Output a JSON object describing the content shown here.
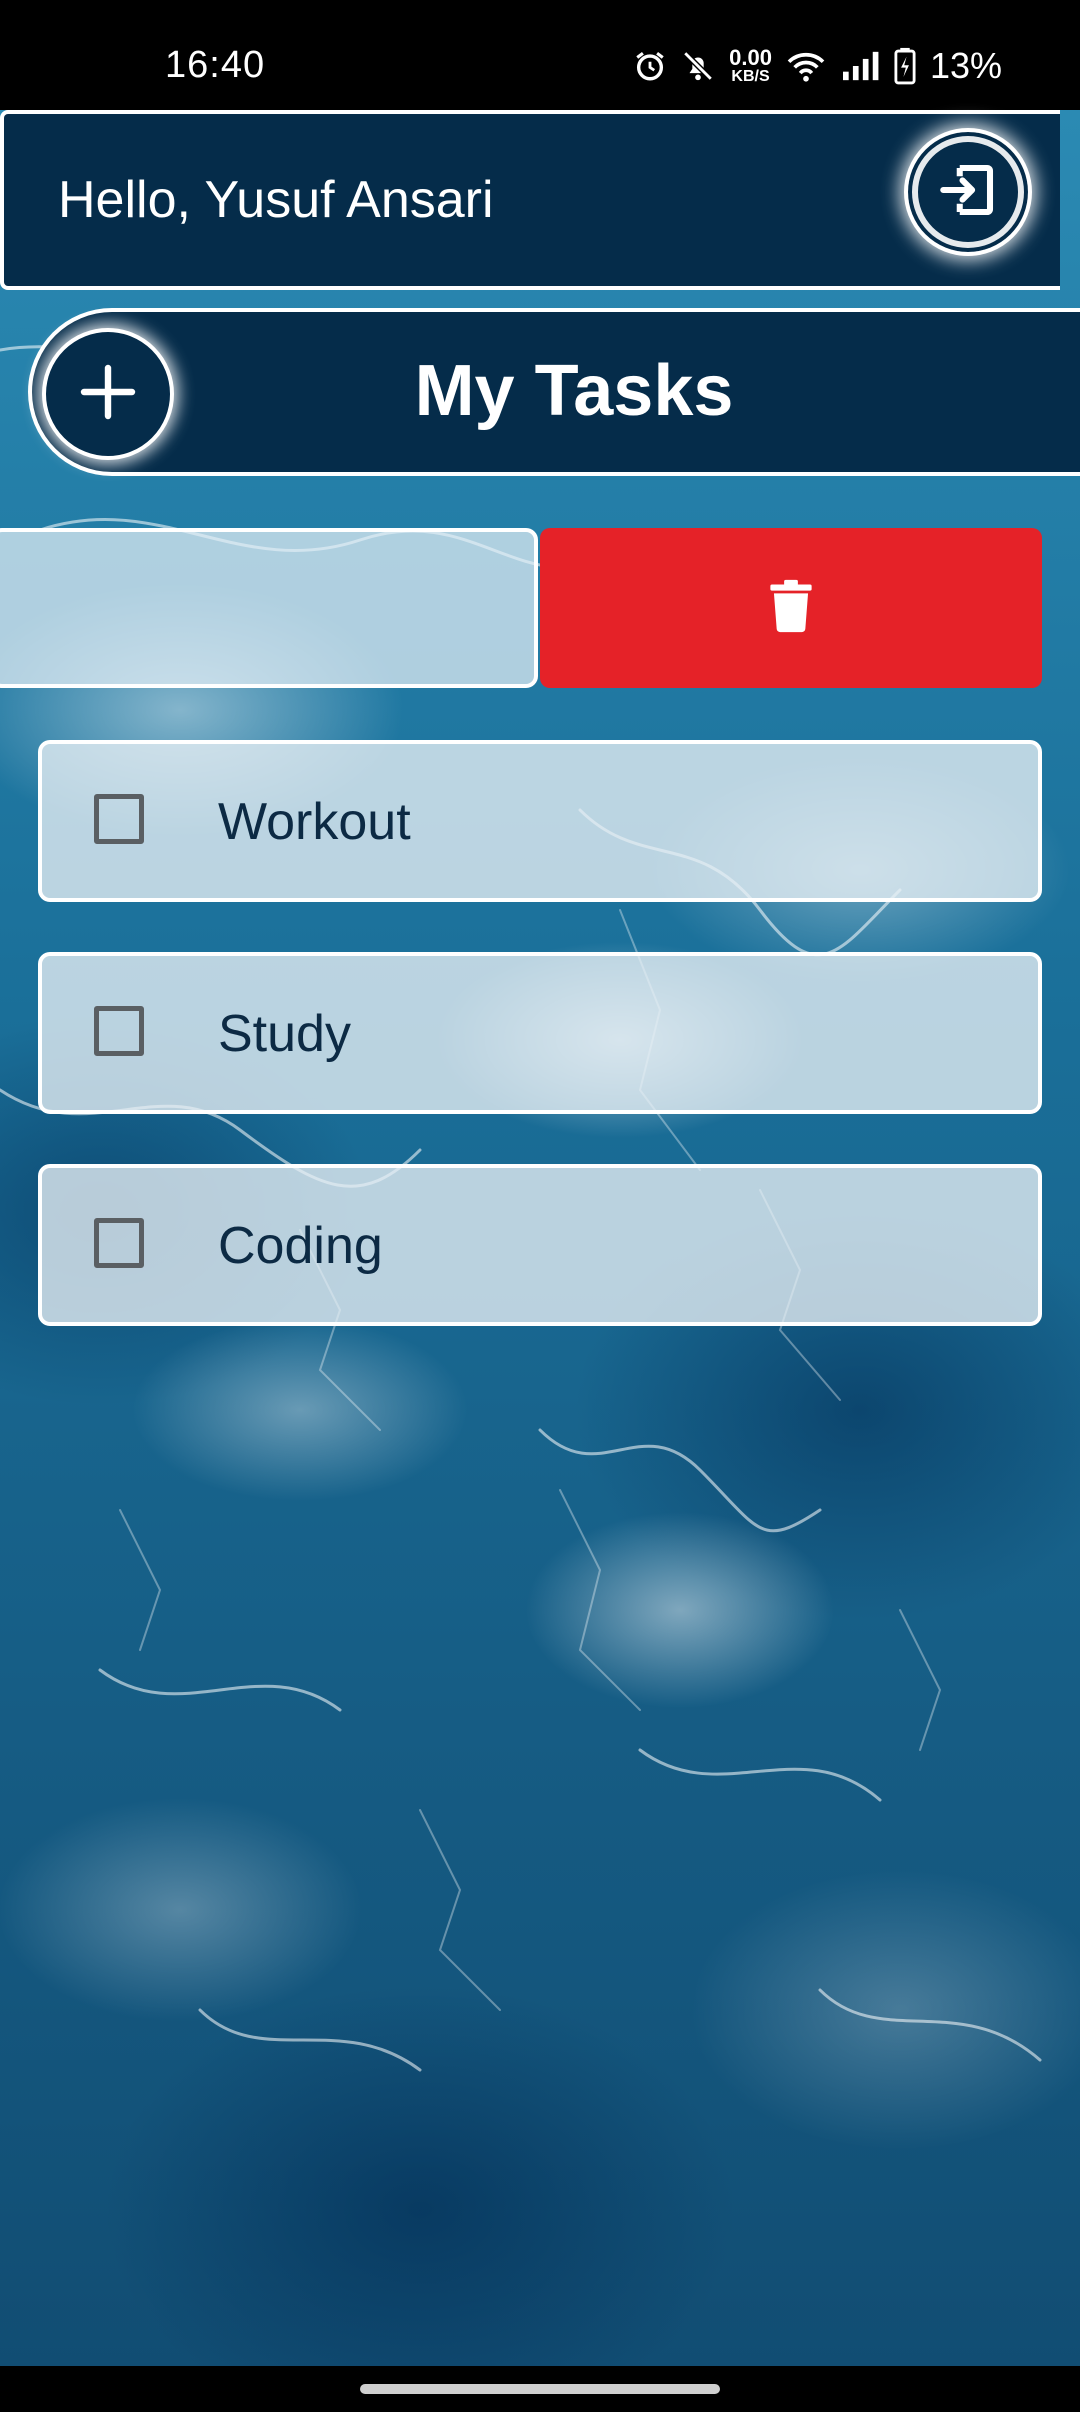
{
  "status_bar": {
    "time": "16:40",
    "net_speed_value": "0.00",
    "net_speed_unit": "KB/S",
    "battery_percent": "13%",
    "icons": [
      "alarm-icon",
      "notifications-off-icon",
      "wifi-icon",
      "signal-icon",
      "battery-charging-icon"
    ]
  },
  "header": {
    "greeting": "Hello, Yusuf Ansari",
    "logout_icon": "logout-icon"
  },
  "title_bar": {
    "add_icon": "plus-icon",
    "title": "My Tasks"
  },
  "swiped_task": {
    "delete_icon": "trash-icon"
  },
  "tasks": [
    {
      "label": "Workout",
      "checked": false
    },
    {
      "label": "Study",
      "checked": false
    },
    {
      "label": "Coding",
      "checked": false
    }
  ],
  "colors": {
    "primary_dark": "#052c4a",
    "delete_red": "#e52228",
    "task_text": "#0c2a44"
  }
}
